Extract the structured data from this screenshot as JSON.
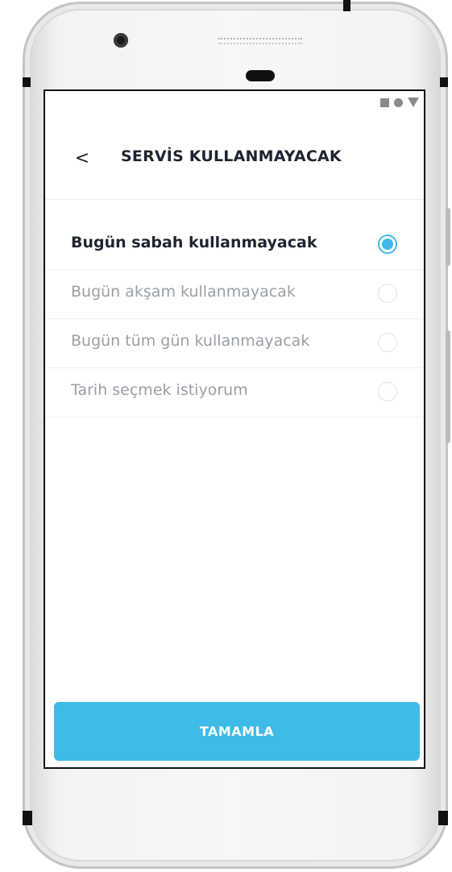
{
  "status_bar": {
    "icons": [
      "square-icon",
      "dot-icon",
      "triangle-icon"
    ]
  },
  "header": {
    "back_icon": "chevron-left-icon",
    "back_glyph": "<",
    "title": "SERVİS KULLANMAYACAK"
  },
  "options": [
    {
      "label": "Bugün sabah kullanmayacak",
      "selected": true
    },
    {
      "label": "Bugün akşam kullanmayacak",
      "selected": false
    },
    {
      "label": "Bugün tüm gün kullanmayacak",
      "selected": false
    },
    {
      "label": "Tarih seçmek istiyorum",
      "selected": false
    }
  ],
  "footer": {
    "complete_label": "TAMAMLA"
  },
  "colors": {
    "accent": "#3fbbe8",
    "text_primary": "#1e2430",
    "text_muted": "#9aa0a6"
  }
}
